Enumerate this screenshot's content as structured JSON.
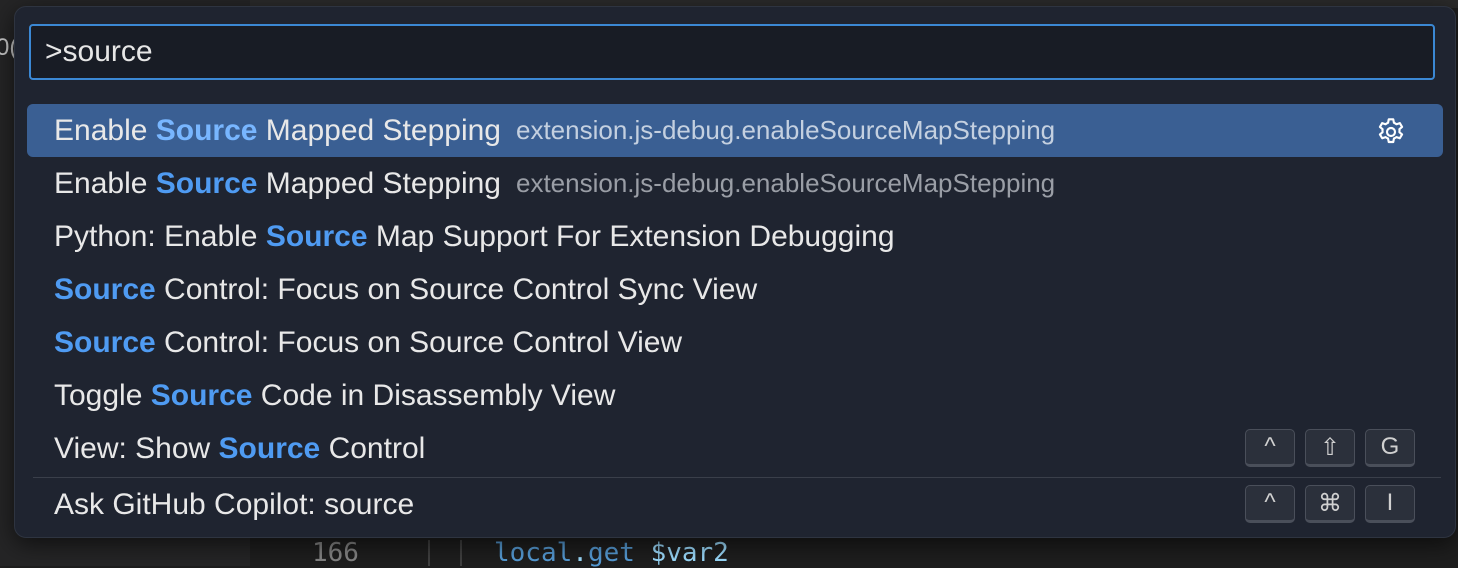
{
  "background": {
    "sidebar_fragment": "0(",
    "line_number": "166",
    "code": {
      "kw1": "local",
      "dot": ".",
      "kw2": "get",
      "var": "$var2"
    }
  },
  "palette": {
    "search_value": ">source",
    "results": [
      {
        "pre": "Enable ",
        "match": "Source",
        "post": " Mapped Stepping",
        "detail": "extension.js-debug.enableSourceMapStepping",
        "selected": true
      },
      {
        "pre": "Enable ",
        "match": "Source",
        "post": " Mapped Stepping",
        "detail": "extension.js-debug.enableSourceMapStepping"
      },
      {
        "pre": "Python: Enable ",
        "match": "Source",
        "post": " Map Support For Extension Debugging"
      },
      {
        "pre": "",
        "match": "Source",
        "post": " Control: Focus on Source Control Sync View"
      },
      {
        "pre": "",
        "match": "Source",
        "post": " Control: Focus on Source Control View"
      },
      {
        "pre": "Toggle ",
        "match": "Source",
        "post": " Code in Disassembly View"
      },
      {
        "pre": "View: Show ",
        "match": "Source",
        "post": " Control",
        "keys": [
          "^",
          "⇧",
          "G"
        ]
      }
    ],
    "copilot": {
      "label": "Ask GitHub Copilot: source",
      "keys": [
        "^",
        "⌘",
        "I"
      ]
    }
  },
  "colors": {
    "accent": "#3b88d4",
    "selection": "#3a5f93",
    "match": "#4f9bf2"
  },
  "icons": {
    "selected_row_action": "gear-icon"
  }
}
